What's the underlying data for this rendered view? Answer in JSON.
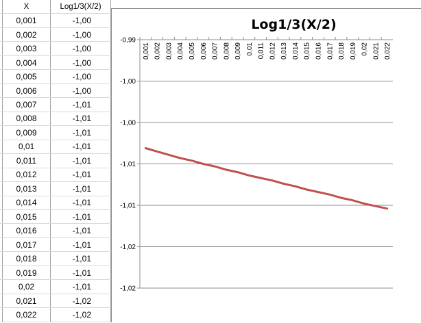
{
  "sheet": {
    "headers": [
      "X",
      "Log1/3(X/2)"
    ],
    "rows": [
      [
        "0,001",
        "-1,00"
      ],
      [
        "0,002",
        "-1,00"
      ],
      [
        "0,003",
        "-1,00"
      ],
      [
        "0,004",
        "-1,00"
      ],
      [
        "0,005",
        "-1,00"
      ],
      [
        "0,006",
        "-1,00"
      ],
      [
        "0,007",
        "-1,01"
      ],
      [
        "0,008",
        "-1,01"
      ],
      [
        "0,009",
        "-1,01"
      ],
      [
        "0,01",
        "-1,01"
      ],
      [
        "0,011",
        "-1,01"
      ],
      [
        "0,012",
        "-1,01"
      ],
      [
        "0,013",
        "-1,01"
      ],
      [
        "0,014",
        "-1,01"
      ],
      [
        "0,015",
        "-1,01"
      ],
      [
        "0,016",
        "-1,01"
      ],
      [
        "0,017",
        "-1,01"
      ],
      [
        "0,018",
        "-1,01"
      ],
      [
        "0,019",
        "-1,01"
      ],
      [
        "0,02",
        "-1,01"
      ],
      [
        "0,021",
        "-1,02"
      ],
      [
        "0,022",
        "-1,02"
      ]
    ]
  },
  "colors": {
    "line": "#c0504d",
    "gridline": "#8c8c8c"
  },
  "chart_data": {
    "type": "line",
    "title": "Log1/3(X/2)",
    "categories": [
      "0,001",
      "0,002",
      "0,003",
      "0,004",
      "0,005",
      "0,006",
      "0,007",
      "0,008",
      "0,009",
      "0,01",
      "0,011",
      "0,012",
      "0,013",
      "0,014",
      "0,015",
      "0,016",
      "0,017",
      "0,018",
      "0,019",
      "0,02",
      "0,021",
      "0,022"
    ],
    "x": [
      0.001,
      0.002,
      0.003,
      0.004,
      0.005,
      0.006,
      0.007,
      0.008,
      0.009,
      0.01,
      0.011,
      0.012,
      0.013,
      0.014,
      0.015,
      0.016,
      0.017,
      0.018,
      0.019,
      0.02,
      0.021,
      0.022
    ],
    "series": [
      {
        "values": [
          -1.0031,
          -1.0035,
          -1.0039,
          -1.0043,
          -1.0046,
          -1.005,
          -1.0053,
          -1.0057,
          -1.006,
          -1.0064,
          -1.0067,
          -1.007,
          -1.0074,
          -1.0077,
          -1.0081,
          -1.0084,
          -1.0087,
          -1.0091,
          -1.0094,
          -1.0098,
          -1.0101,
          -1.0104
        ]
      }
    ],
    "yticks": [
      -0.99,
      -0.995,
      -1.0,
      -1.005,
      -1.01,
      -1.015,
      -1.02
    ],
    "ytick_labels": [
      "-0,99",
      "-1,00",
      "-1,00",
      "-1,01",
      "-1,01",
      "-1,02",
      "-1,02"
    ],
    "ylim": [
      -1.02,
      -0.99
    ],
    "grid": true,
    "legend": "none"
  }
}
